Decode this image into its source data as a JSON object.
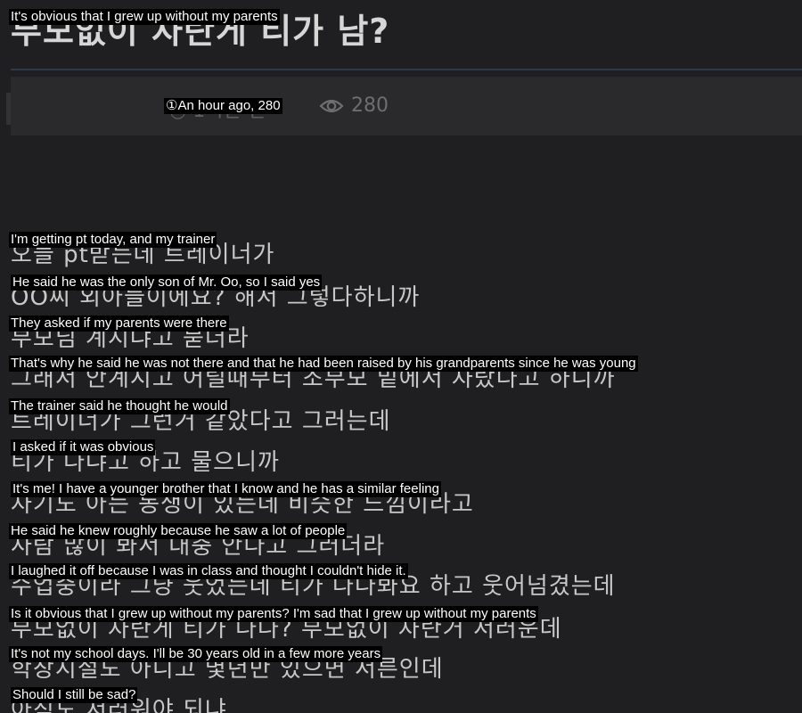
{
  "post": {
    "title_korean": "부모없이 자란게 티가 남?",
    "title_caption": "It's obvious that I grew up without my parents",
    "meta_caption": "①An hour ago, 280",
    "meta_korean_ghost": "◷ 1시간 전",
    "views": "280",
    "icons": {
      "views": "eye-icon"
    }
  },
  "lines": [
    {
      "korean": "오늘 pt받는데 트레이너가",
      "caption": "I'm getting pt today, and my trainer"
    },
    {
      "korean": "OO씨 외아들이에요? 해서 그렇다하니까",
      "caption": "He said he was the only son of Mr. Oo, so I said yes"
    },
    {
      "korean": "부모님 계시냐고 묻더라",
      "caption": "They asked if my parents were there"
    },
    {
      "korean": "그래서 안계시고 어릴때부터 조부모 밑에서 자랐다고 하니까",
      "caption": "That's why he said he was not there and that he had been raised by his grandparents since he was young"
    },
    {
      "korean": "트레이너가 그런거 같았다고 그러는데",
      "caption": "The trainer said he thought he would"
    },
    {
      "korean": "티가 나냐고 하고 물으니까",
      "caption": "I asked if it was obvious"
    },
    {
      "korean": "자기도 아는 동생이 있는데 비슷한 느낌이라고",
      "caption": "It's me! I have a younger brother that I know and he has a similar feeling"
    },
    {
      "korean": "사람 많이 봐서 대충 안다고 그러더라",
      "caption": "He said he knew roughly because he saw a lot of people"
    },
    {
      "korean": "수업중이라 그냥 웃었는데 티가 나나봐요 하고 웃어넘겼는데",
      "caption": "I laughed it off because I was in class and thought I couldn't hide it."
    },
    {
      "korean": "부모없이 자란게 티가 나나? 부모없이 자란거 서러운데",
      "caption": "Is it obvious that I grew up without my parents? I'm sad that I grew up without my parents"
    },
    {
      "korean": "학창시절도 아니고 몇년만 있으면 서른인데",
      "caption": "It's not my school days. I'll be 30 years old in a few more years"
    },
    {
      "korean": "아직도 서러워야 되냐..",
      "caption": "Should I still be sad?"
    }
  ]
}
